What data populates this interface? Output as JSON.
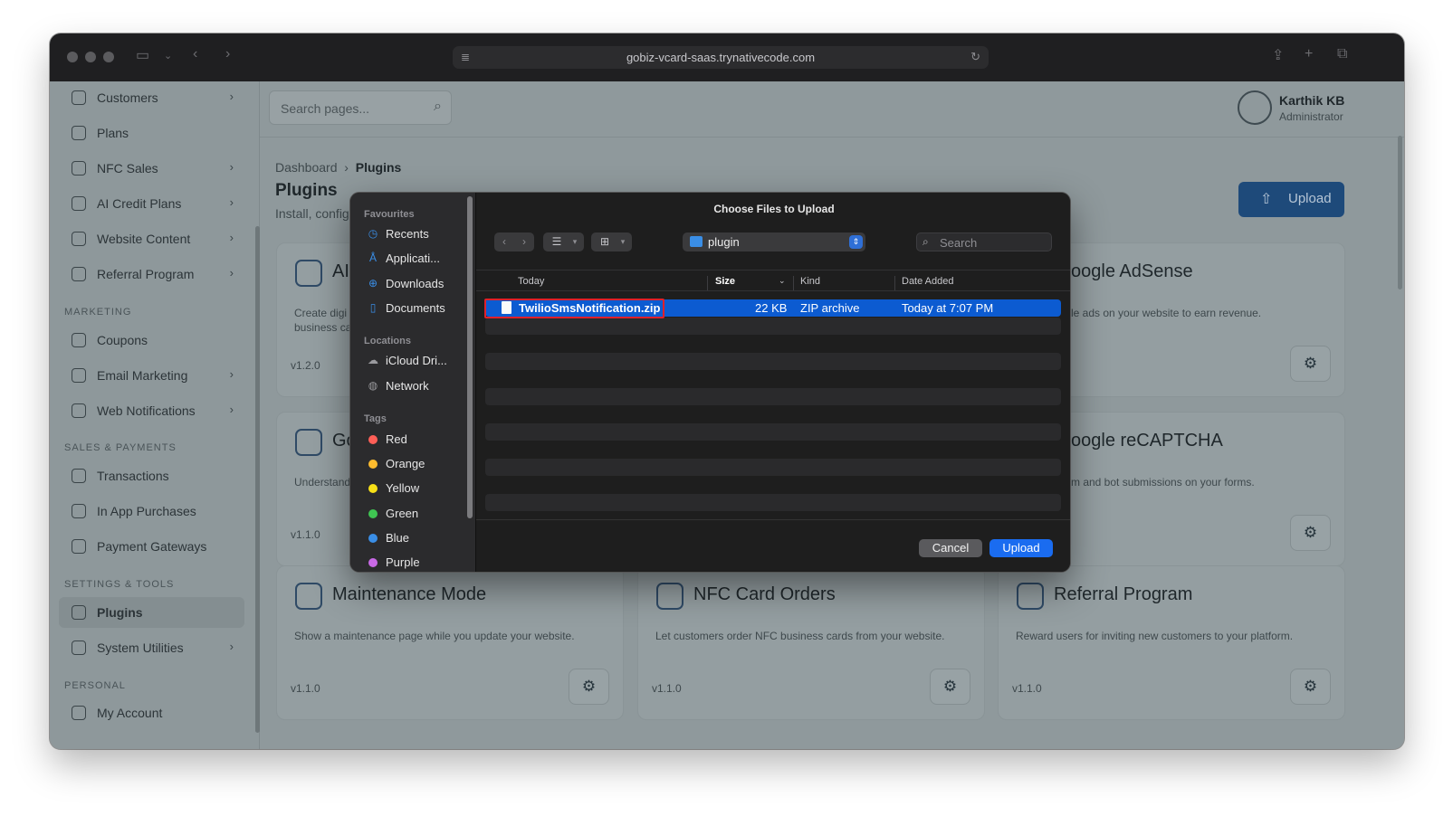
{
  "browser": {
    "url": "gobiz-vcard-saas.trynativecode.com"
  },
  "sidebar": {
    "items_top": [
      {
        "label": "Customers",
        "chevron": true
      },
      {
        "label": "Plans",
        "chevron": false
      },
      {
        "label": "NFC Sales",
        "chevron": true
      },
      {
        "label": "AI Credit Plans",
        "chevron": true
      },
      {
        "label": "Website Content",
        "chevron": true
      },
      {
        "label": "Referral Program",
        "chevron": true
      }
    ],
    "section_marketing": "MARKETING",
    "items_marketing": [
      {
        "label": "Coupons",
        "chevron": false
      },
      {
        "label": "Email Marketing",
        "chevron": true
      },
      {
        "label": "Web Notifications",
        "chevron": true
      }
    ],
    "section_sales": "SALES & PAYMENTS",
    "items_sales": [
      {
        "label": "Transactions"
      },
      {
        "label": "In App Purchases"
      },
      {
        "label": "Payment Gateways"
      }
    ],
    "section_settings": "SETTINGS & TOOLS",
    "items_settings": [
      {
        "label": "Plugins",
        "active": true
      },
      {
        "label": "System Utilities",
        "chevron": true
      }
    ],
    "section_personal": "PERSONAL",
    "items_personal": [
      {
        "label": "My Account"
      }
    ]
  },
  "header": {
    "search_placeholder": "Search pages...",
    "user_name": "Karthik KB",
    "user_role": "Administrator"
  },
  "main": {
    "breadcrumb_root": "Dashboard",
    "breadcrumb_sep": "›",
    "breadcrumb_current": "Plugins",
    "title": "Plugins",
    "subtitle": "Install, config",
    "upload_label": "Upload",
    "cards": [
      {
        "title": "AI",
        "desc": "Create digi",
        "desc2": "business ca",
        "version": "v1.2.0"
      },
      {
        "title": "oogle AdSense",
        "desc": "le ads on your website to earn revenue.",
        "version": ""
      },
      {
        "title": "Go",
        "desc": "Understand",
        "version": "v1.1.0"
      },
      {
        "title": "oogle reCAPTCHA",
        "desc": "m and bot submissions on your forms.",
        "version": ""
      },
      {
        "title": "Maintenance Mode",
        "desc": "Show a maintenance page while you update your website.",
        "version": "v1.1.0"
      },
      {
        "title": "NFC Card Orders",
        "desc": "Let customers order NFC business cards from your website.",
        "version": "v1.1.0"
      },
      {
        "title": "Referral Program",
        "desc": "Reward users for inviting new customers to your platform.",
        "version": "v1.1.0"
      }
    ]
  },
  "dialog": {
    "title": "Choose Files to Upload",
    "sidebar": {
      "favourites_label": "Favourites",
      "favourites": [
        "Recents",
        "Applicati...",
        "Downloads",
        "Documents"
      ],
      "locations_label": "Locations",
      "locations": [
        "iCloud Dri...",
        "Network"
      ],
      "tags_label": "Tags",
      "tags": [
        {
          "label": "Red",
          "color": "#ff5f57"
        },
        {
          "label": "Orange",
          "color": "#febc2e"
        },
        {
          "label": "Yellow",
          "color": "#f7e017"
        },
        {
          "label": "Green",
          "color": "#3fc552"
        },
        {
          "label": "Blue",
          "color": "#3a8ee6"
        },
        {
          "label": "Purple",
          "color": "#c969e6"
        }
      ]
    },
    "folder": "plugin",
    "search_placeholder": "Search",
    "columns": {
      "name": "Today",
      "size": "Size",
      "kind": "Kind",
      "date": "Date Added"
    },
    "files": [
      {
        "name": "TwilioSmsNotification.zip",
        "size": "22 KB",
        "kind": "ZIP archive",
        "date": "Today at 7:07 PM",
        "selected": true
      }
    ],
    "cancel_label": "Cancel",
    "upload_label": "Upload"
  }
}
